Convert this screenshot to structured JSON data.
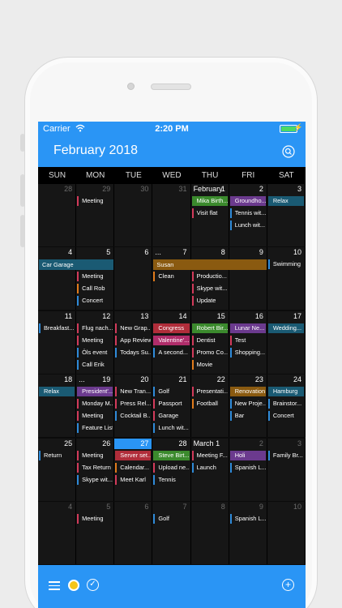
{
  "status": {
    "carrier": "Carrier",
    "time": "2:20 PM"
  },
  "header": {
    "title": "February 2018"
  },
  "weekdays": [
    "SUN",
    "MON",
    "TUE",
    "WED",
    "THU",
    "FRI",
    "SAT"
  ],
  "colors": {
    "accent": "#2a95f5",
    "red": "#d23a5a",
    "blue": "#2e8ad8",
    "green": "#3b8a2d",
    "purple": "#6b3a8e",
    "orange": "#b86d12",
    "teal": "#1a5a73",
    "pink": "#b02d6a"
  },
  "weeks": [
    {
      "days": [
        {
          "num": "28",
          "dim": true,
          "events": []
        },
        {
          "num": "29",
          "dim": true,
          "events": [
            {
              "t": "Meeting",
              "c": "#d23a5a"
            }
          ]
        },
        {
          "num": "30",
          "dim": true,
          "events": []
        },
        {
          "num": "31",
          "dim": true,
          "events": []
        },
        {
          "num": "1",
          "left": "February",
          "events": [
            {
              "t": "Mika Birth...",
              "c": "#3b8a2d",
              "fill": true
            },
            {
              "t": "Visit flat",
              "c": "#d23a5a"
            }
          ]
        },
        {
          "num": "2",
          "events": [
            {
              "t": "Groundho...",
              "c": "#6b3a8e",
              "fill": true
            },
            {
              "t": "Tennis wit...",
              "c": "#2e8ad8"
            },
            {
              "t": "Lunch wit...",
              "c": "#2e8ad8"
            }
          ]
        },
        {
          "num": "3",
          "events": [
            {
              "t": "Relax",
              "c": "#1a5a73",
              "fill": true
            }
          ]
        }
      ]
    },
    {
      "days": [
        {
          "num": "4",
          "events": []
        },
        {
          "num": "5",
          "events": [
            {
              "t": "Meeting",
              "c": "#d23a5a"
            },
            {
              "t": "Call Rob",
              "c": "#e07a1a"
            },
            {
              "t": "Concert",
              "c": "#2e8ad8"
            }
          ]
        },
        {
          "num": "6",
          "events": []
        },
        {
          "num": "7",
          "left": "...",
          "events": [
            {
              "t": "Clean",
              "c": "#e07a1a"
            }
          ]
        },
        {
          "num": "8",
          "events": [
            {
              "t": "Productio...",
              "c": "#d23a5a"
            },
            {
              "t": "Skype wit...",
              "c": "#d23a5a"
            },
            {
              "t": "Update",
              "c": "#d23a5a"
            }
          ]
        },
        {
          "num": "9",
          "events": []
        },
        {
          "num": "10",
          "events": [
            {
              "t": "Swimming",
              "c": "#2e8ad8"
            }
          ]
        }
      ],
      "bars": [
        {
          "t": "Car Garage",
          "c": "#1a5a73",
          "from": 0,
          "to": 1
        },
        {
          "t": "Susan",
          "c": "#8a5a10",
          "from": 3,
          "to": 5
        }
      ]
    },
    {
      "days": [
        {
          "num": "11",
          "events": [
            {
              "t": "Breakfast...",
              "c": "#2e8ad8"
            }
          ]
        },
        {
          "num": "12",
          "events": [
            {
              "t": "Flug nach...",
              "c": "#d23a5a"
            },
            {
              "t": "Meeting",
              "c": "#d23a5a"
            },
            {
              "t": "Öls event",
              "c": "#2e8ad8"
            },
            {
              "t": "Call Erik",
              "c": "#2e8ad8"
            }
          ]
        },
        {
          "num": "13",
          "events": [
            {
              "t": "New Grap...",
              "c": "#d23a5a"
            },
            {
              "t": "App Review",
              "c": "#d23a5a"
            },
            {
              "t": "Todays Su...",
              "c": "#2e8ad8"
            }
          ]
        },
        {
          "num": "14",
          "events": [
            {
              "t": "Congress",
              "c": "#b02d3a",
              "fill": true
            },
            {
              "t": "Valentine'...",
              "c": "#b02d6a",
              "fill": true
            },
            {
              "t": "A second...",
              "c": "#2e8ad8"
            }
          ]
        },
        {
          "num": "15",
          "events": [
            {
              "t": "Robert Bir...",
              "c": "#3b8a2d",
              "fill": true
            },
            {
              "t": "Dentist",
              "c": "#d23a5a"
            },
            {
              "t": "Promo Co...",
              "c": "#d23a5a"
            },
            {
              "t": "Movie",
              "c": "#e07a1a"
            }
          ]
        },
        {
          "num": "16",
          "events": [
            {
              "t": "Lunar Ne...",
              "c": "#6b3a8e",
              "fill": true
            },
            {
              "t": "Test",
              "c": "#d23a5a"
            },
            {
              "t": "Shopping...",
              "c": "#2e8ad8"
            }
          ]
        },
        {
          "num": "17",
          "events": [
            {
              "t": "Wedding...",
              "c": "#1a5a73",
              "fill": true
            }
          ]
        }
      ]
    },
    {
      "days": [
        {
          "num": "18",
          "events": [
            {
              "t": "Relax",
              "c": "#1a5a73",
              "fill": true
            }
          ]
        },
        {
          "num": "19",
          "left": "...",
          "events": [
            {
              "t": "President'...",
              "c": "#6b3a8e",
              "fill": true
            },
            {
              "t": "Monday M...",
              "c": "#d23a5a"
            },
            {
              "t": "Meeting",
              "c": "#d23a5a"
            },
            {
              "t": "Feature List",
              "c": "#2e8ad8"
            }
          ]
        },
        {
          "num": "20",
          "events": [
            {
              "t": "New Tran...",
              "c": "#d23a5a"
            },
            {
              "t": "Press Rel...",
              "c": "#d23a5a"
            },
            {
              "t": "Cocktail B...",
              "c": "#2e8ad8"
            }
          ]
        },
        {
          "num": "21",
          "events": [
            {
              "t": "Golf",
              "c": "#2e8ad8"
            },
            {
              "t": "Passport",
              "c": "#d23a5a"
            },
            {
              "t": "Garage",
              "c": "#d23a5a"
            },
            {
              "t": "Lunch wit...",
              "c": "#2e8ad8"
            }
          ]
        },
        {
          "num": "22",
          "events": [
            {
              "t": "Presentati...",
              "c": "#d23a5a"
            },
            {
              "t": "Football",
              "c": "#e07a1a"
            }
          ]
        },
        {
          "num": "23",
          "events": [
            {
              "t": "Renovation",
              "c": "#8a5a10",
              "fill": true
            },
            {
              "t": "New Proje...",
              "c": "#2e8ad8"
            },
            {
              "t": "Bar",
              "c": "#2e8ad8"
            }
          ]
        },
        {
          "num": "24",
          "events": [
            {
              "t": "Hamburg",
              "c": "#1a5a73",
              "fill": true
            },
            {
              "t": "Brainstor...",
              "c": "#2e8ad8"
            },
            {
              "t": "Concert",
              "c": "#2e8ad8"
            }
          ]
        }
      ]
    },
    {
      "days": [
        {
          "num": "25",
          "events": [
            {
              "t": "Return",
              "c": "#2e8ad8"
            }
          ]
        },
        {
          "num": "26",
          "events": [
            {
              "t": "Meeting",
              "c": "#d23a5a"
            },
            {
              "t": "Tax Return",
              "c": "#d23a5a"
            },
            {
              "t": "Skype wit...",
              "c": "#2e8ad8"
            }
          ]
        },
        {
          "num": "27",
          "today": true,
          "events": [
            {
              "t": "Server set...",
              "c": "#b02d3a",
              "fill": true
            },
            {
              "t": "Calendar...",
              "c": "#e07a1a"
            },
            {
              "t": "Meet Karl",
              "c": "#d23a5a"
            }
          ]
        },
        {
          "num": "28",
          "events": [
            {
              "t": "Steve Birt...",
              "c": "#3b8a2d",
              "fill": true
            },
            {
              "t": "Upload ne...",
              "c": "#d23a5a"
            },
            {
              "t": "Tennis",
              "c": "#2e8ad8"
            }
          ]
        },
        {
          "num": "",
          "left": "March 1",
          "events": [
            {
              "t": "Meeting F...",
              "c": "#d23a5a"
            },
            {
              "t": "Launch",
              "c": "#2e8ad8"
            }
          ]
        },
        {
          "num": "2",
          "dim": true,
          "events": [
            {
              "t": "Holi",
              "c": "#6b3a8e",
              "fill": true
            },
            {
              "t": "Spanish L...",
              "c": "#2e8ad8"
            }
          ]
        },
        {
          "num": "3",
          "dim": true,
          "events": [
            {
              "t": "Family Br...",
              "c": "#2e8ad8"
            }
          ]
        }
      ]
    },
    {
      "days": [
        {
          "num": "4",
          "dim": true,
          "events": []
        },
        {
          "num": "5",
          "dim": true,
          "events": [
            {
              "t": "Meeting",
              "c": "#d23a5a"
            }
          ]
        },
        {
          "num": "6",
          "dim": true,
          "events": []
        },
        {
          "num": "7",
          "dim": true,
          "events": [
            {
              "t": "Golf",
              "c": "#2e8ad8"
            }
          ]
        },
        {
          "num": "8",
          "dim": true,
          "events": []
        },
        {
          "num": "9",
          "dim": true,
          "events": [
            {
              "t": "Spanish L...",
              "c": "#2e8ad8"
            }
          ]
        },
        {
          "num": "10",
          "dim": true,
          "events": []
        }
      ]
    }
  ],
  "icons": {
    "wifi": "wifi-icon",
    "battery": "battery-icon",
    "search": "search-icon",
    "menu": "menu-icon",
    "today": "sun-icon",
    "tasks": "check-icon",
    "add": "plus-icon"
  }
}
